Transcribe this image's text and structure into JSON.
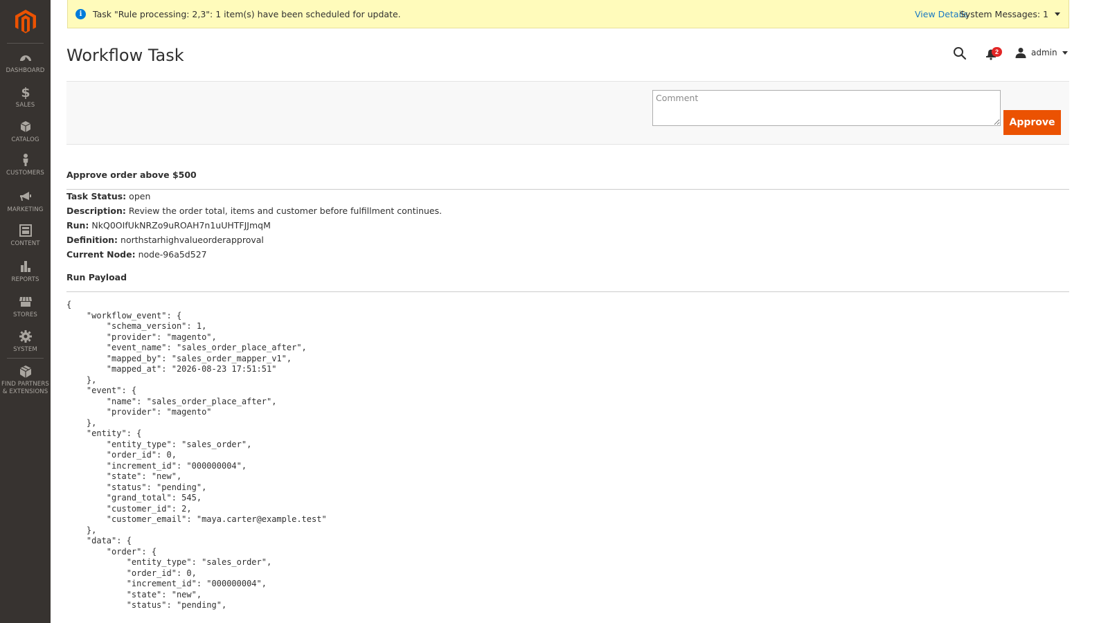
{
  "sidebar": {
    "items": [
      {
        "label": "DASHBOARD",
        "icon": "dashboard-icon"
      },
      {
        "label": "SALES",
        "icon": "dollar-icon"
      },
      {
        "label": "CATALOG",
        "icon": "box-icon"
      },
      {
        "label": "CUSTOMERS",
        "icon": "person-icon"
      },
      {
        "label": "MARKETING",
        "icon": "megaphone-icon"
      },
      {
        "label": "CONTENT",
        "icon": "layout-icon"
      },
      {
        "label": "REPORTS",
        "icon": "bar-chart-icon"
      },
      {
        "label": "STORES",
        "icon": "store-icon"
      },
      {
        "label": "SYSTEM",
        "icon": "gear-icon"
      },
      {
        "label": "FIND PARTNERS & EXTENSIONS",
        "icon": "extensions-icon"
      }
    ]
  },
  "notice": {
    "text": "Task \"Rule processing: 2,3\": 1 item(s) have been scheduled for update.",
    "view_details": "View Details",
    "system_messages": "System Messages: 1"
  },
  "header": {
    "title": "Workflow Task",
    "notifications_count": "2",
    "user_name": "admin"
  },
  "action_bar": {
    "comment_placeholder": "Comment",
    "approve_label": "Approve"
  },
  "task": {
    "section_title": "Approve order above $500",
    "status_label": "Task Status:",
    "status": "open",
    "description_label": "Description:",
    "description": "Review the order total, items and customer before fulfillment continues.",
    "run_label": "Run:",
    "run": "NkQ0OIfUkNRZo9uROAH7n1uUHTFJJmqM",
    "definition_label": "Definition:",
    "definition": "northstarhighvalueorderapproval",
    "node_label": "Current Node:",
    "node": "node-96a5d527"
  },
  "payload": {
    "section_title": "Run Payload",
    "text": "{\n    \"workflow_event\": {\n        \"schema_version\": 1,\n        \"provider\": \"magento\",\n        \"event_name\": \"sales_order_place_after\",\n        \"mapped_by\": \"sales_order_mapper_v1\",\n        \"mapped_at\": \"2026-08-23 17:51:51\"\n    },\n    \"event\": {\n        \"name\": \"sales_order_place_after\",\n        \"provider\": \"magento\"\n    },\n    \"entity\": {\n        \"entity_type\": \"sales_order\",\n        \"order_id\": 0,\n        \"increment_id\": \"000000004\",\n        \"state\": \"new\",\n        \"status\": \"pending\",\n        \"grand_total\": 545,\n        \"customer_id\": 2,\n        \"customer_email\": \"maya.carter@example.test\"\n    },\n    \"data\": {\n        \"order\": {\n            \"entity_type\": \"sales_order\",\n            \"order_id\": 0,\n            \"increment_id\": \"000000004\",\n            \"state\": \"new\",\n            \"status\": \"pending\","
  },
  "colors": {
    "sidebar_bg": "#373330",
    "accent": "#eb5202",
    "notice_bg": "#fffbbb",
    "link": "#1979c3",
    "badge": "#e22626"
  }
}
